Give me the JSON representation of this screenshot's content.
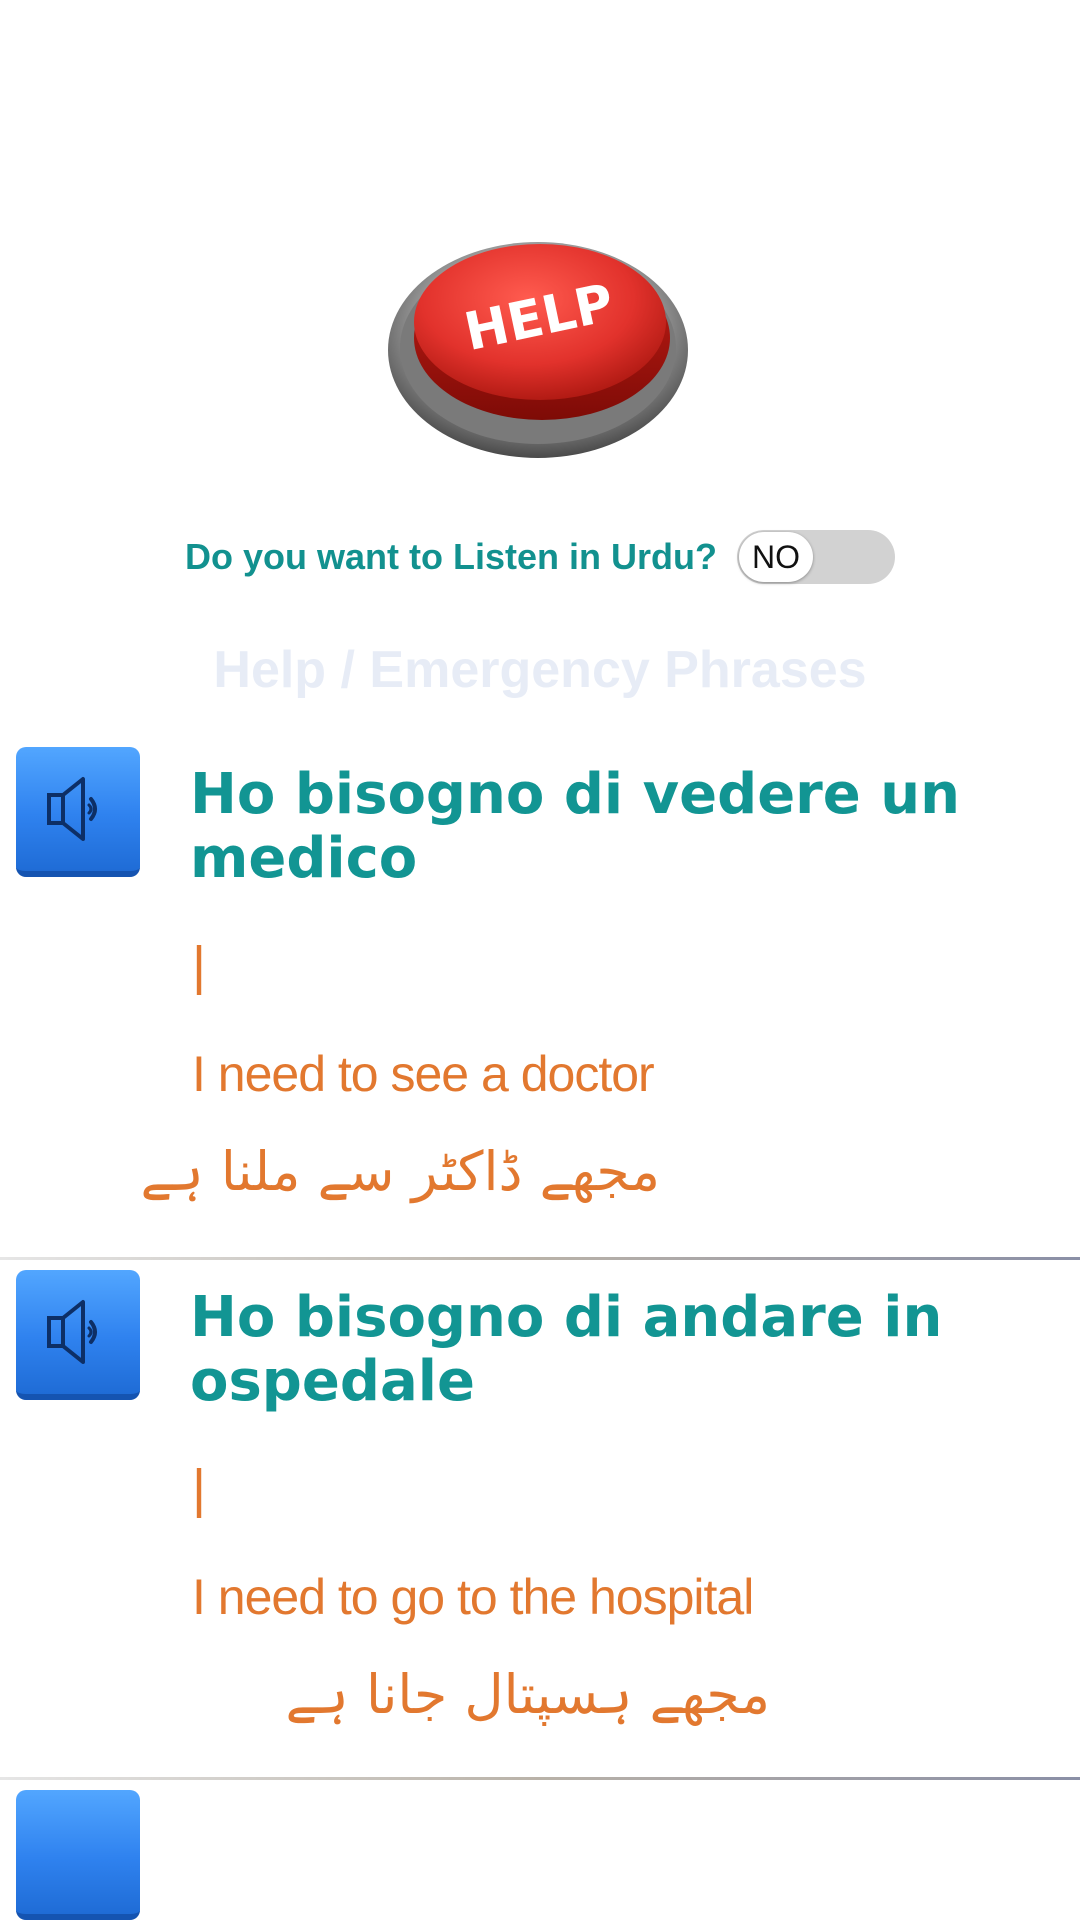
{
  "hero": {
    "button_text": "HELP",
    "colors": {
      "red": "#e2322c",
      "ring": "#8f8f8f"
    }
  },
  "listen_toggle": {
    "label": "Do you want to Listen in Urdu?",
    "state": "NO"
  },
  "section_title": "Help / Emergency Phrases",
  "phrases": [
    {
      "italian": "Ho bisogno di vedere un medico",
      "pronunciation": "|",
      "english": "I need to see a doctor",
      "urdu": "مجھے ڈاکٹر سے ملنا ہے"
    },
    {
      "italian": "Ho bisogno di andare in ospedale",
      "pronunciation": "|",
      "english": "I need to go to the hospital",
      "urdu": "مجھے ہسپتال جانا ہے"
    }
  ],
  "colors": {
    "accent_teal": "#129593",
    "accent_orange": "#e2782f",
    "speaker_blue": "#2f82ef"
  },
  "icons": {
    "speaker": "speaker-icon"
  }
}
